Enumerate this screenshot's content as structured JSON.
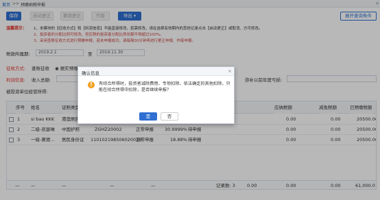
{
  "titlebar": {
    "home": "首页",
    "sep": ">>",
    "current": "预缴纳税申报",
    "close": "×"
  },
  "toolbar": {
    "save": "保存",
    "start_correct": "启动更正",
    "cancel_correct": "撤销更正",
    "void": "作废",
    "export": "导出 ▾",
    "expand_query": "展开查询条件"
  },
  "tips": {
    "label": "温馨提示：",
    "lines": [
      "1、本模块的【征收方式】和【利润信息】不能直接修改，若需修改，请在选择有效期内的其他记录点击【启动更正】或取消、方可修改。",
      "2、投资者的分配比例可修改，但应税的投资者分配比例总额不得超过100%。",
      "3、采用查账征收方式进行预缴申报，若未申报成功，请每隔30分钟再进行更正申报、作废申报。"
    ]
  },
  "period": {
    "label": "税款所属期:",
    "from": "2019.2.1",
    "to_label": "至",
    "to": "2019.11.30"
  },
  "collection": {
    "label": "征收方式:",
    "value": "查账征收",
    "option1": "据实预缴",
    "option2": "按上年应纳税所得额"
  },
  "profit": {
    "label": "利润信息:",
    "income_label": "收入总额:",
    "loss_label": "弥补以前年度亏损:"
  },
  "unit": {
    "label": "被投资单位经营所得:"
  },
  "table": {
    "headers": [
      "序号",
      "姓名",
      "证照类型",
      "",
      "",
      "",
      "应纳税额",
      "减免税额",
      "已预缴税额"
    ],
    "rows": [
      {
        "no": "1",
        "name": "si bao KKK",
        "idtype": "港澳居民",
        "id": "",
        "kind": "",
        "status": "",
        "tax": "0.00",
        "reduce": "0.00",
        "paid": "20500.00"
      },
      {
        "no": "2",
        "name": "二级-凯瑟琳",
        "idtype": "中国护照",
        "id": "ZGHZ20002",
        "kind": "正常申报",
        "ratio": "30.9999%",
        "status": "待申报",
        "tax": "0.00",
        "reduce": "0.00",
        "paid": "20500.00"
      },
      {
        "no": "3",
        "name": "一级-黄德...",
        "idtype": "居民身份证",
        "id": "110102198506020018",
        "kind": "正常申报",
        "ratio": "18.88%",
        "status": "待申报",
        "tax": "0.00",
        "reduce": "0.00",
        "paid": "20500.00"
      }
    ],
    "footer": {
      "d1": "—",
      "d2": "—",
      "d3": "—",
      "d4": "—",
      "d5": "—",
      "count": "记录数: 3",
      "t1": "0.00",
      "t2": "0.00",
      "t3": "0.00",
      "paid_total": "61,000.0"
    }
  },
  "dialog": {
    "title": "确认信息",
    "message": "有综合所得时，投资者减除费用、专项扣除、依法确定的其他扣除，只能在综合所得中扣除，是否继续申报？",
    "yes": "是",
    "no": "否",
    "icon": "warning-icon"
  }
}
